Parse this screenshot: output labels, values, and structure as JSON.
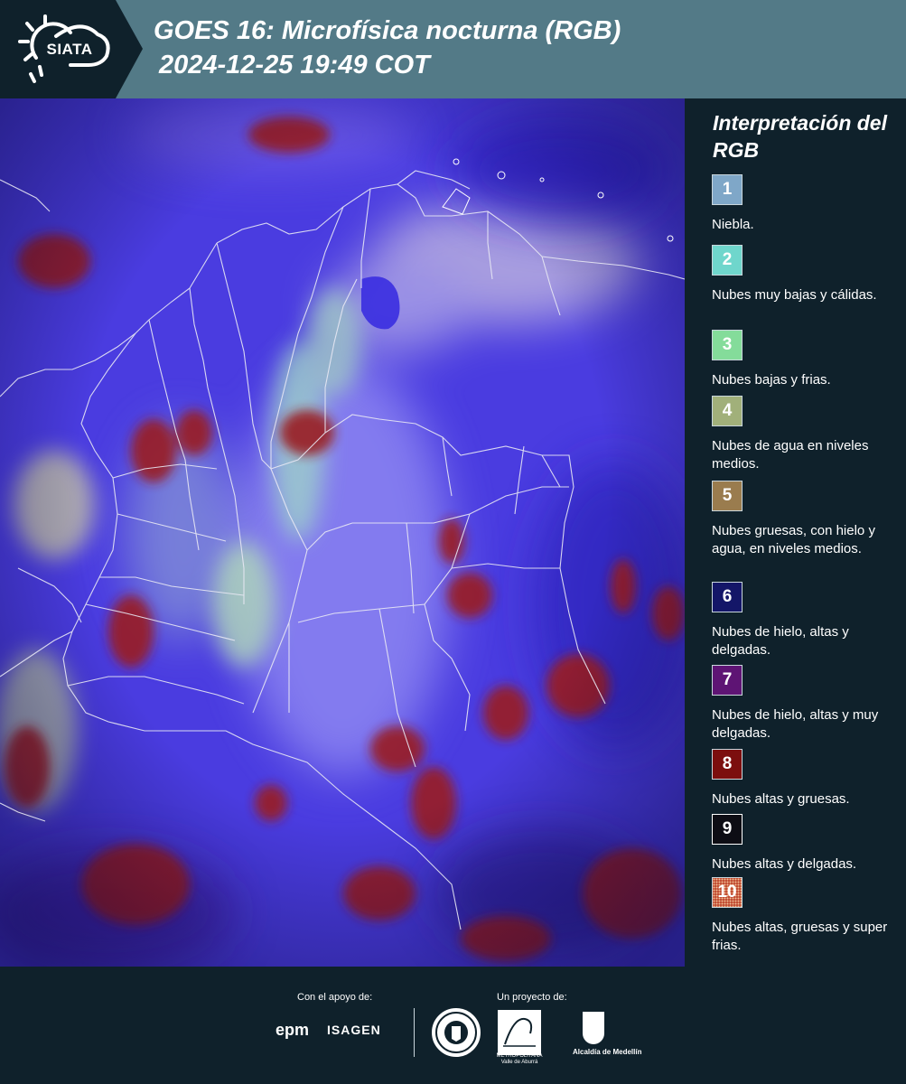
{
  "header": {
    "logo_text": "SIATA",
    "title_line1": "GOES 16: Microfísica nocturna (RGB)",
    "title_line2": "2024-12-25 19:49 COT"
  },
  "legend": {
    "title": "Interpretación del RGB",
    "items": [
      {
        "number": "1",
        "label": "Niebla.",
        "color": "#7fa7c8"
      },
      {
        "number": "2",
        "label": "Nubes muy bajas y cálidas.",
        "color": "#6fd6cc"
      },
      {
        "number": "3",
        "label": "Nubes bajas y frias.",
        "color": "#84dc9a"
      },
      {
        "number": "4",
        "label": "Nubes de agua en niveles medios.",
        "color": "#a1b07a"
      },
      {
        "number": "5",
        "label": "Nubes gruesas, con hielo y agua, en niveles medios.",
        "color": "#9a7c4e"
      },
      {
        "number": "6",
        "label": "Nubes de hielo, altas y delgadas.",
        "color": "#141668"
      },
      {
        "number": "7",
        "label": "Nubes de hielo, altas y muy delgadas.",
        "color": "#5e1474"
      },
      {
        "number": "8",
        "label": "Nubes altas y gruesas.",
        "color": "#7c0e0e"
      },
      {
        "number": "9",
        "label": "Nubes altas y delgadas.",
        "color": "#0d0d14"
      },
      {
        "number": "10",
        "label": "Nubes altas, gruesas y super frias.",
        "color": "#b8361f"
      }
    ]
  },
  "footer": {
    "support_label": "Con el apoyo de:",
    "project_label": "Un proyecto de:",
    "epm": "epm",
    "isagen": "ISAGEN",
    "area_caption": "METROPOLITANA Valle de Aburrá",
    "alcaldia": "Alcaldía de Medellín"
  },
  "colors": {
    "header_bg": "#537a87",
    "page_bg": "#0f212b",
    "map_base": "#4a3ce0"
  }
}
